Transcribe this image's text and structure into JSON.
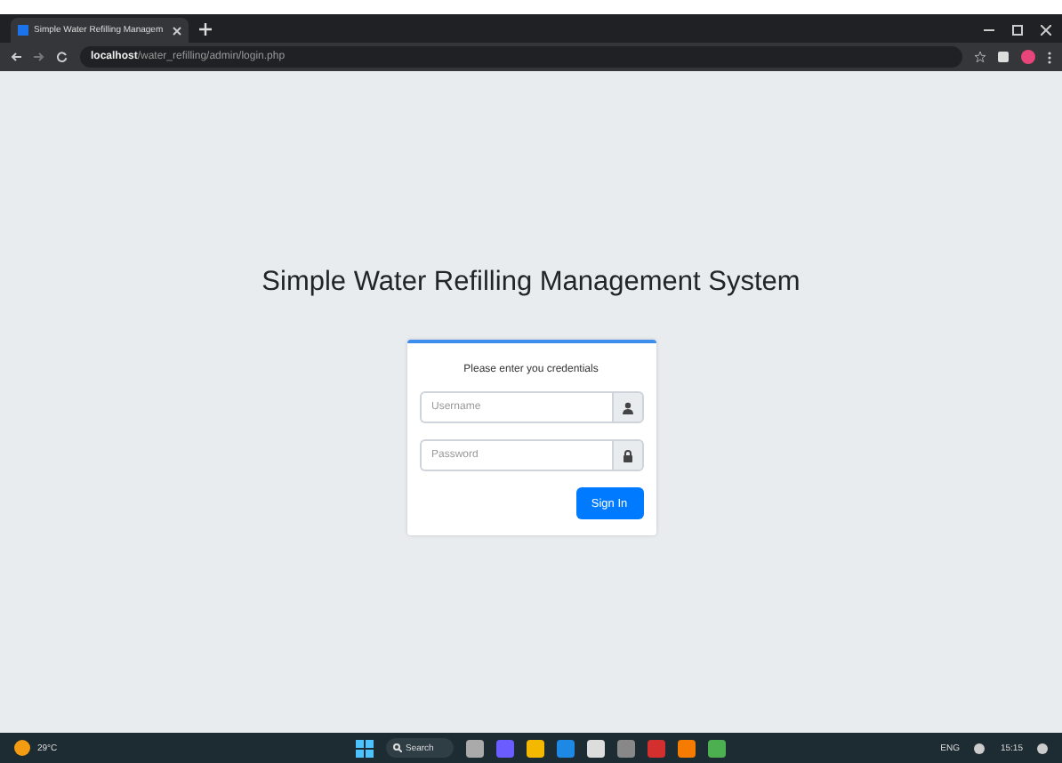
{
  "browser": {
    "tab_title": "Simple Water Refilling Managem",
    "url_host": "localhost",
    "url_path": "/water_refilling/admin/login.php"
  },
  "page": {
    "title": "Simple Water Refilling Management System",
    "card": {
      "message": "Please enter you credentials",
      "fields": [
        {
          "kind": "user",
          "placeholder": "Username"
        },
        {
          "kind": "lock",
          "placeholder": "Password"
        }
      ],
      "button": "Sign In"
    }
  },
  "taskbar": {
    "weather": "29°C",
    "search": "Search",
    "language": "ENG",
    "time": "15:15"
  }
}
